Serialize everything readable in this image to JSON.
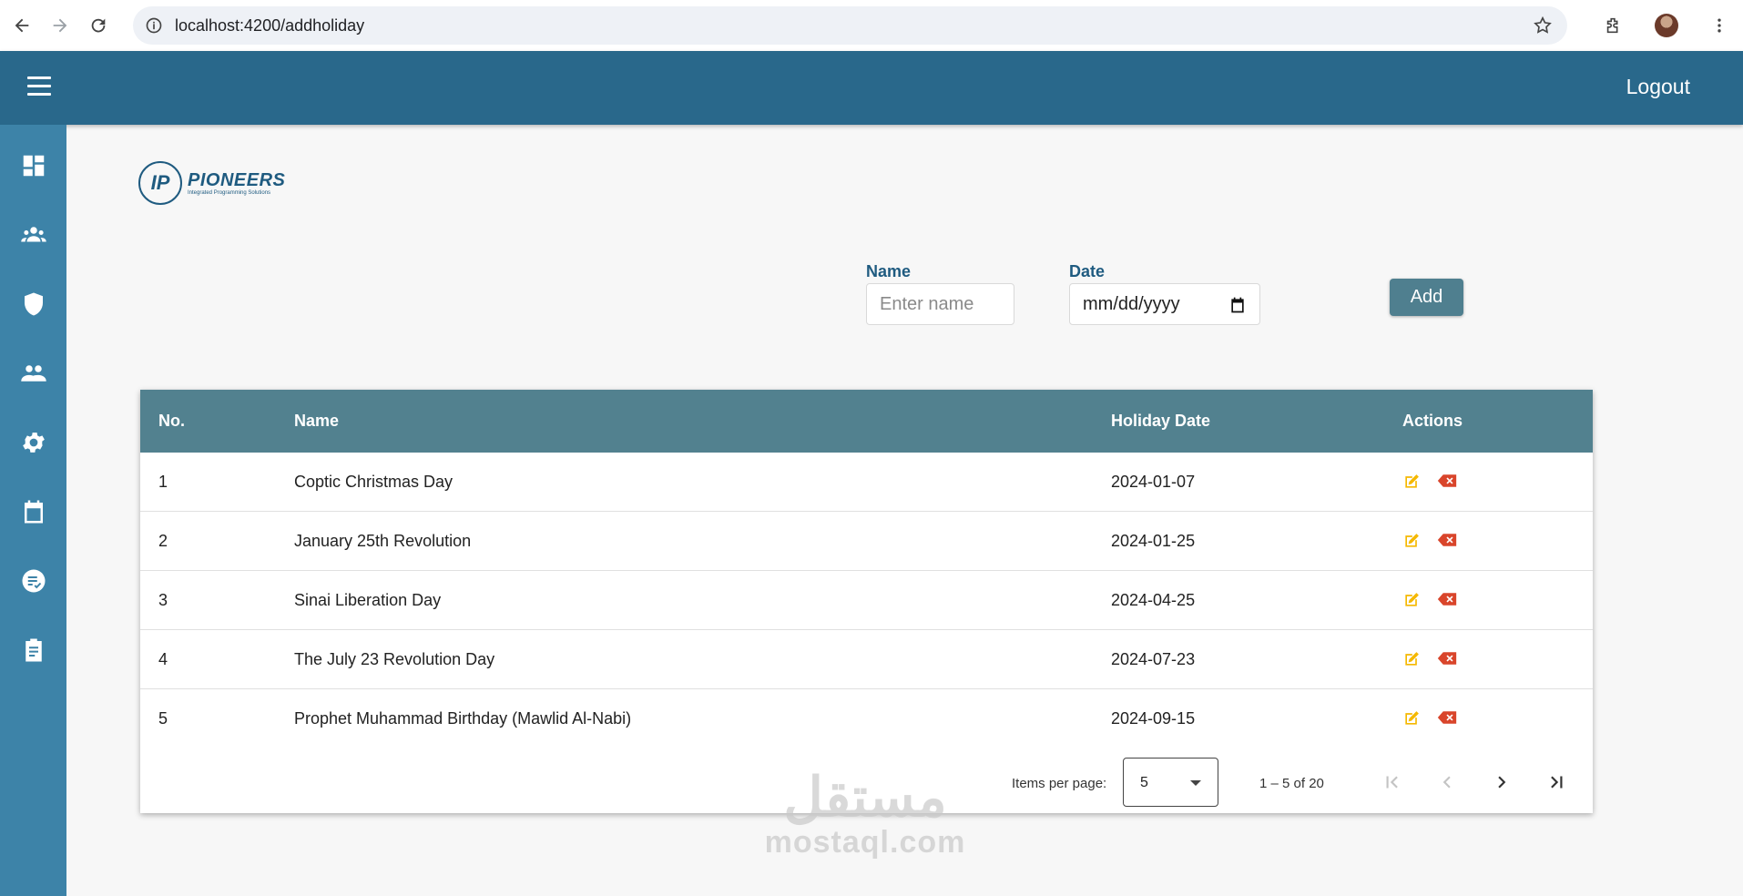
{
  "browser": {
    "url": "localhost:4200/addholiday"
  },
  "header": {
    "logout_label": "Logout"
  },
  "sidebar": {
    "items": [
      {
        "icon": "dashboard-icon"
      },
      {
        "icon": "users-group-icon"
      },
      {
        "icon": "shield-icon"
      },
      {
        "icon": "team-icon"
      },
      {
        "icon": "gear-icon"
      },
      {
        "icon": "calendar-icon"
      },
      {
        "icon": "checklist-icon"
      },
      {
        "icon": "clipboard-icon"
      }
    ]
  },
  "logo": {
    "mark": "IP",
    "name": "PIONEERS",
    "tagline": "Integrated Programming Solutions"
  },
  "form": {
    "name_label": "Name",
    "name_placeholder": "Enter name",
    "date_label": "Date",
    "date_placeholder": "mm/dd/yyyy",
    "add_label": "Add"
  },
  "table": {
    "columns": [
      "No.",
      "Name",
      "Holiday Date",
      "Actions"
    ],
    "rows": [
      {
        "no": "1",
        "name": "Coptic Christmas Day",
        "date": "2024-01-07"
      },
      {
        "no": "2",
        "name": "January 25th Revolution",
        "date": "2024-01-25"
      },
      {
        "no": "3",
        "name": "Sinai Liberation Day",
        "date": "2024-04-25"
      },
      {
        "no": "4",
        "name": "The July 23 Revolution Day",
        "date": "2024-07-23"
      },
      {
        "no": "5",
        "name": "Prophet Muhammad Birthday (Mawlid Al-Nabi)",
        "date": "2024-09-15"
      }
    ]
  },
  "paginator": {
    "items_per_page_label": "Items per page:",
    "items_per_page_value": "5",
    "range_label": "1 – 5 of 20"
  },
  "watermark": {
    "arabic": "مستقل",
    "latin": "mostaql.com"
  },
  "colors": {
    "header": "#29688b",
    "sidebar": "#3d83a8",
    "table_header": "#52818f",
    "edit": "#f5b800",
    "delete": "#d9452b"
  }
}
